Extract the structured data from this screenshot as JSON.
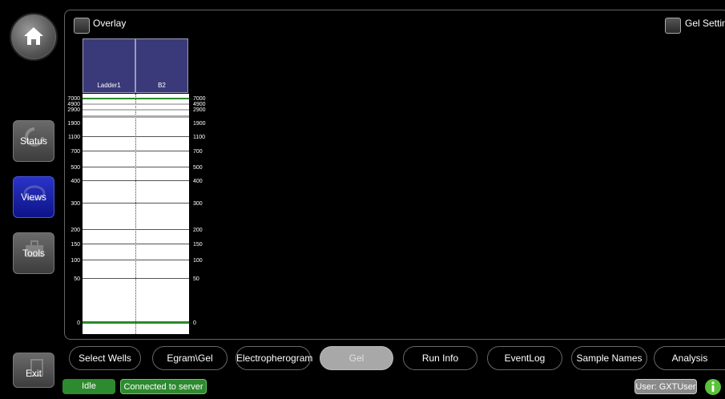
{
  "nav": {
    "status": "Status",
    "views": "Views",
    "tools": "Tools",
    "exit": "Exit"
  },
  "options": {
    "overlay": "Overlay",
    "gel_settings": "Gel Settings"
  },
  "gel": {
    "lanes": [
      "Ladder1",
      "B2"
    ],
    "ladder": [
      "7000",
      "4900",
      "2900",
      "1900",
      "1100",
      "700",
      "500",
      "400",
      "300",
      "200",
      "150",
      "100",
      "50",
      "0"
    ],
    "marker_color": "#2a8a2a"
  },
  "tabs": [
    "Select Wells",
    "Egram\\Gel",
    "Electropherogram",
    "Gel",
    "Run Info",
    "EventLog",
    "Sample Names",
    "Analysis Settings"
  ],
  "active_tab": "Gel",
  "status": {
    "state": "Idle",
    "connection": "Connected to server",
    "user": "User: GXTUser",
    "state_color": "#2e8a2e"
  }
}
